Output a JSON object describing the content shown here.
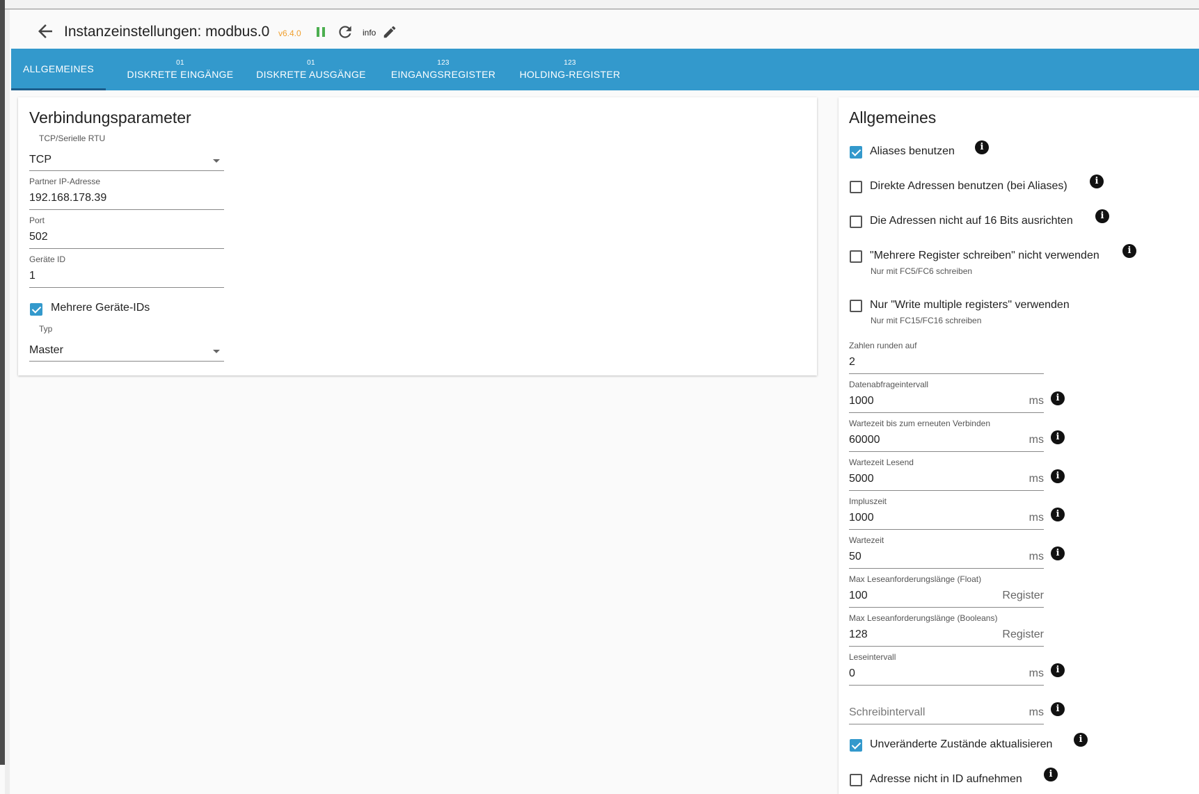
{
  "header": {
    "title": "Instanzeinstellungen: modbus.0",
    "version": "v6.4.0",
    "info_label": "info"
  },
  "tabs": [
    {
      "label": "ALLGEMEINES",
      "badge": ""
    },
    {
      "label": "DISKRETE EINGÄNGE",
      "badge": "01"
    },
    {
      "label": "DISKRETE AUSGÄNGE",
      "badge": "01"
    },
    {
      "label": "EINGANGSREGISTER",
      "badge": "123"
    },
    {
      "label": "HOLDING-REGISTER",
      "badge": "123"
    }
  ],
  "connection": {
    "title": "Verbindungsparameter",
    "protocol": {
      "label": "TCP/Serielle RTU",
      "value": "TCP"
    },
    "ip": {
      "label": "Partner IP-Adresse",
      "value": "192.168.178.39"
    },
    "port": {
      "label": "Port",
      "value": "502"
    },
    "device_id": {
      "label": "Geräte ID",
      "value": "1"
    },
    "multi_ids": {
      "label": "Mehrere Geräte-IDs",
      "checked": true
    },
    "type": {
      "label": "Typ",
      "value": "Master"
    }
  },
  "general": {
    "title": "Allgemeines",
    "options": [
      {
        "label": "Aliases benutzen",
        "checked": true,
        "hint": ""
      },
      {
        "label": "Direkte Adressen benutzen (bei Aliases)",
        "checked": false,
        "hint": ""
      },
      {
        "label": "Die Adressen nicht auf 16 Bits ausrichten",
        "checked": false,
        "hint": ""
      },
      {
        "label": "\"Mehrere Register schreiben\" nicht verwenden",
        "checked": false,
        "hint": "Nur mit FC5/FC6 schreiben"
      },
      {
        "label": "Nur \"Write multiple registers\" verwenden",
        "checked": false,
        "hint": "Nur mit FC15/FC16 schreiben"
      }
    ],
    "fields": [
      {
        "label": "Zahlen runden auf",
        "value": "2",
        "unit": ""
      },
      {
        "label": "Datenabfrageintervall",
        "value": "1000",
        "unit": "ms"
      },
      {
        "label": "Wartezeit bis zum erneuten Verbinden",
        "value": "60000",
        "unit": "ms"
      },
      {
        "label": "Wartezeit Lesend",
        "value": "5000",
        "unit": "ms"
      },
      {
        "label": "Impluszeit",
        "value": "1000",
        "unit": "ms"
      },
      {
        "label": "Wartezeit",
        "value": "50",
        "unit": "ms"
      },
      {
        "label": "Max Leseanforderungslänge (Float)",
        "value": "100",
        "unit": "Register"
      },
      {
        "label": "Max Leseanforderungslänge (Booleans)",
        "value": "128",
        "unit": "Register"
      },
      {
        "label": "Leseintervall",
        "value": "0",
        "unit": "ms"
      },
      {
        "label": "",
        "placeholder": "Schreibintervall",
        "value": "",
        "unit": "ms"
      }
    ],
    "bottom_options": [
      {
        "label": "Unveränderte Zustände aktualisieren",
        "checked": true
      },
      {
        "label": "Adresse nicht in ID aufnehmen",
        "checked": false
      }
    ]
  },
  "colors": {
    "accent": "#3399cc",
    "version": "#f0a030",
    "pause": "#4caf50"
  },
  "icons": [
    "arrow-back-icon",
    "pause-icon",
    "refresh-icon",
    "edit-icon",
    "info-icon",
    "dropdown-caret-icon"
  ]
}
